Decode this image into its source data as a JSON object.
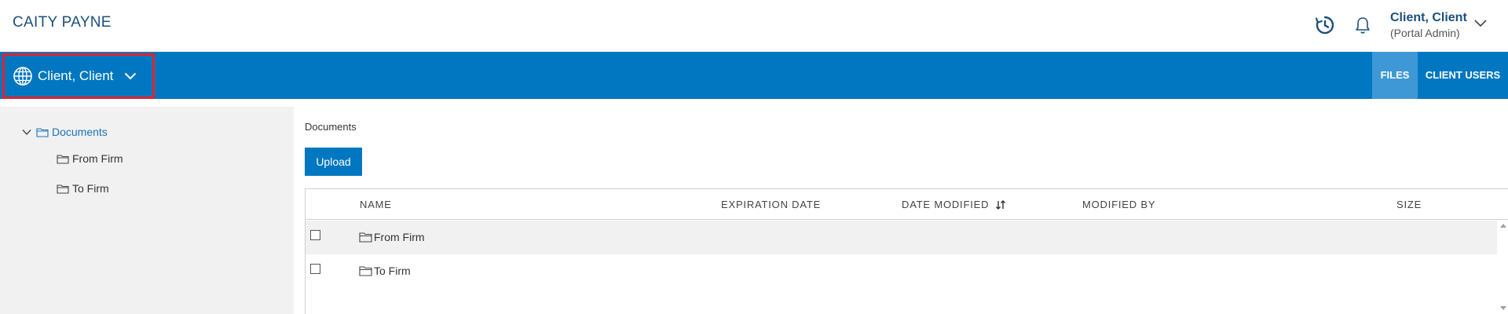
{
  "header": {
    "firm_name": "CAITY PAYNE",
    "user_name": "Client, Client",
    "user_role": "(Portal Admin)",
    "icons": [
      "history-icon",
      "bell-icon",
      "chevron-down-icon"
    ]
  },
  "nav": {
    "client_selector": "Client, Client",
    "tabs": [
      "FILES",
      "CLIENT USERS"
    ],
    "active_tab": "FILES"
  },
  "tree": {
    "root": "Documents",
    "children": [
      "From Firm",
      "To Firm"
    ]
  },
  "main": {
    "breadcrumb": "Documents",
    "upload_label": "Upload",
    "columns": [
      "NAME",
      "EXPIRATION DATE",
      "DATE MODIFIED",
      "MODIFIED BY",
      "SIZE"
    ],
    "sort_column": "DATE MODIFIED",
    "rows": [
      {
        "name": "From Firm",
        "type": "folder"
      },
      {
        "name": "To Firm",
        "type": "folder"
      }
    ]
  },
  "colors": {
    "primary": "#0077c0",
    "active_tab": "#3f98d6",
    "highlight_border": "#e0232e",
    "firm_text": "#1c4f7c"
  }
}
